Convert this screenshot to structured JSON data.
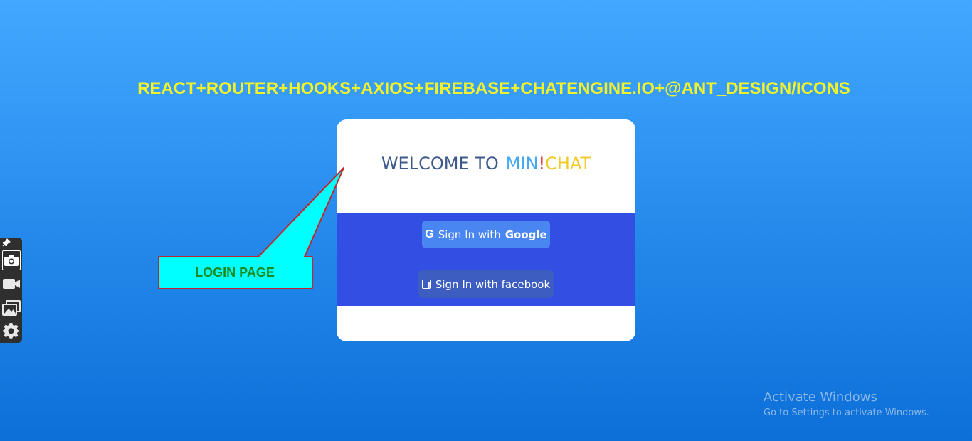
{
  "header": {
    "tech_stack": "REACT+ROUTER+HOOKS+AXIOS+FIREBASE+CHATENGINE.IO+@ANT_DESIGN/ICONS"
  },
  "login_card": {
    "welcome_text": "WELCOME TO",
    "brand_min": "MIN",
    "brand_bang": "!",
    "brand_chat": "CHAT",
    "google_button": {
      "prefix": "Sign In with",
      "provider": "Google",
      "icon": "google-icon"
    },
    "facebook_button": {
      "label": "Sign In with facebook",
      "icon": "facebook-icon"
    }
  },
  "annotation": {
    "label": "LOGIN PAGE"
  },
  "side_toolbar": {
    "tools": [
      "pin-icon",
      "camera-icon",
      "video-icon",
      "gallery-icon",
      "settings-icon"
    ]
  },
  "watermark": {
    "title": "Activate Windows",
    "subtitle": "Go to Settings to activate Windows."
  },
  "colors": {
    "background_top": "#41a9ff",
    "background_bottom": "#0b6fd8",
    "header_text": "#f2f22a",
    "band": "#334fe3",
    "google_button": "#4a86f2",
    "facebook_button": "#3d5ec0",
    "brand_min": "#45a8f5",
    "brand_bang": "#e82c2c",
    "brand_chat": "#f0cb2c",
    "callout_fill": "#00ffff",
    "callout_border": "#c0272d",
    "callout_text": "#1e8a1e"
  }
}
